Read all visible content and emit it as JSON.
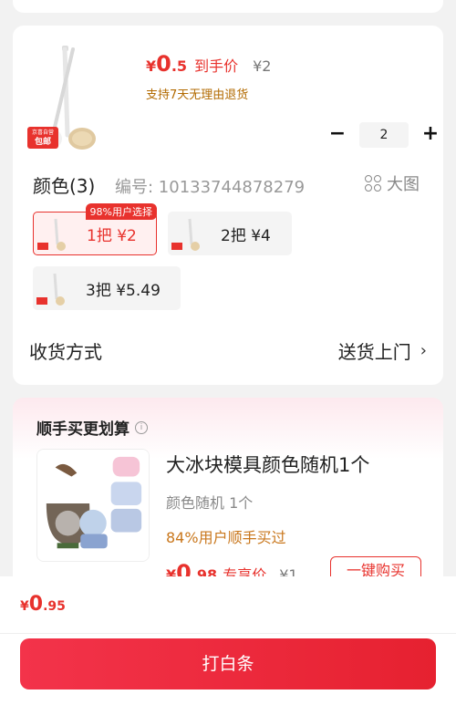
{
  "product": {
    "price_symbol": "¥",
    "price_int": "0",
    "price_dec": ".5",
    "price_label": "到手价",
    "original_price": "¥2",
    "return_note": "支持7天无理由退货",
    "badge_top": "京喜自营",
    "badge_bottom": "包邮",
    "icon": "back-scrubber-brush"
  },
  "quantity": {
    "minus": "−",
    "value": "2",
    "plus": "+"
  },
  "sku": {
    "color_title": "颜色(3)",
    "id_text": "编号: 10133744878279",
    "big_image_label": "大图",
    "variants": [
      {
        "label": "1把  ¥2",
        "badge": "98%用户选择",
        "selected": true
      },
      {
        "label": "2把  ¥4",
        "selected": false
      },
      {
        "label": "3把  ¥5.49",
        "selected": false
      }
    ]
  },
  "delivery": {
    "label": "收货方式",
    "value": "送货上门",
    "chevron": "›"
  },
  "addon": {
    "title": "顺手买更划算",
    "info": "i",
    "name": "大冰块模具颜色随机1个",
    "spec": "颜色随机   1个",
    "buyers": "84%用户顺手买过",
    "price_symbol": "¥",
    "price_int": "0",
    "price_dec": ".98",
    "price_label": "专享价",
    "original_price": "¥1",
    "buy_label": "一键购买",
    "icon": "ice-mold-set"
  },
  "footer": {
    "total_symbol": "¥",
    "total_int": "0",
    "total_dec": ".95",
    "pay_label": "打白条"
  },
  "colors": {
    "accent": "#e8322d",
    "orange_text": "#c9771c",
    "page_bg": "#f2f2f2"
  }
}
